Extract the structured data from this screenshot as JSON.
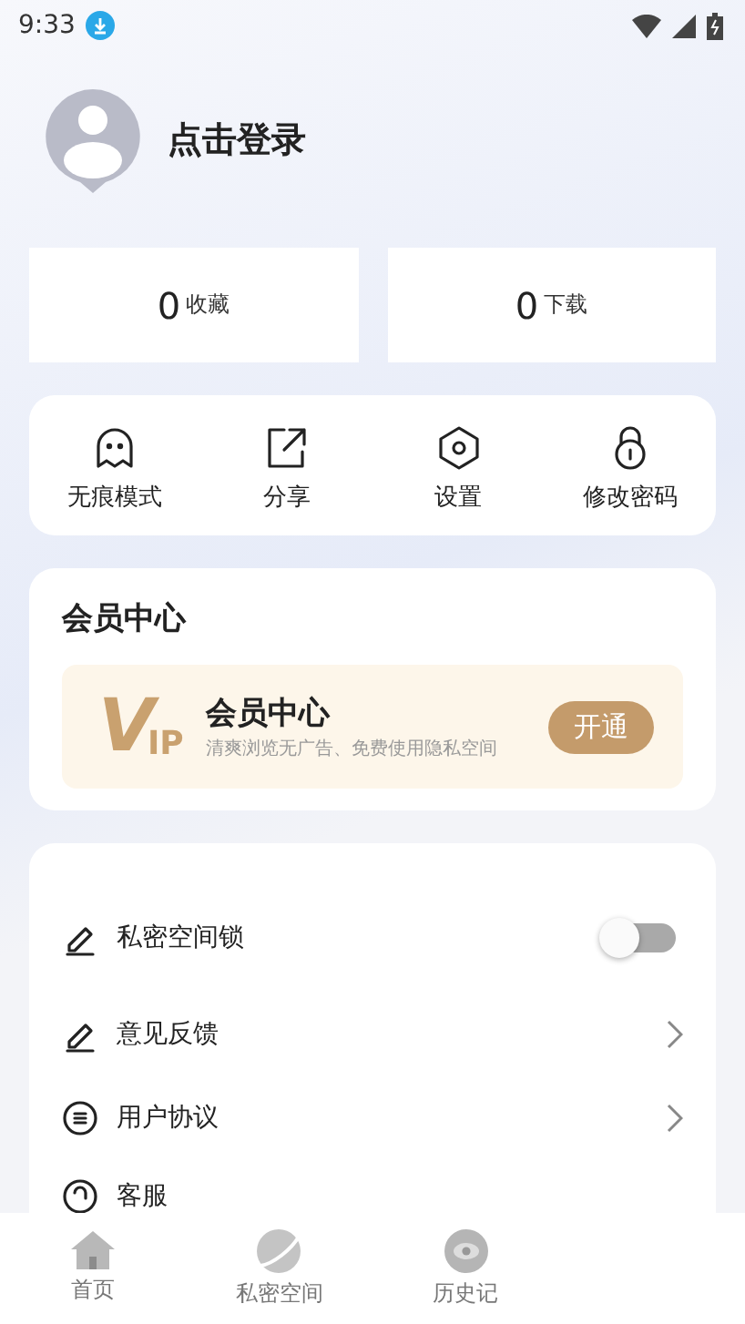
{
  "status_bar": {
    "time": "9:33"
  },
  "profile": {
    "login_label": "点击登录"
  },
  "stats": [
    {
      "count": "0",
      "label": "收藏"
    },
    {
      "count": "0",
      "label": "下载"
    }
  ],
  "shortcuts": [
    {
      "kind": "ghost",
      "label": "无痕模式"
    },
    {
      "kind": "share",
      "label": "分享"
    },
    {
      "kind": "settings",
      "label": "设置"
    },
    {
      "kind": "lock",
      "label": "修改密码"
    }
  ],
  "vip_section": {
    "title": "会员中心",
    "banner": {
      "logo_v": "V",
      "logo_ip": "IP",
      "title": "会员中心",
      "subtitle": "清爽浏览无广告、免费使用隐私空间",
      "button": "开通"
    }
  },
  "settings_list": [
    {
      "kind": "toggle",
      "label": "私密空间锁",
      "on": false
    },
    {
      "kind": "link",
      "label": "意见反馈"
    },
    {
      "kind": "link",
      "label": "用户协议"
    },
    {
      "kind": "plain",
      "label": "客服"
    }
  ],
  "tab_bar": [
    {
      "label": "首页",
      "selected": false
    },
    {
      "label": "私密空间",
      "selected": false
    },
    {
      "label": "历史记",
      "selected": false
    }
  ]
}
